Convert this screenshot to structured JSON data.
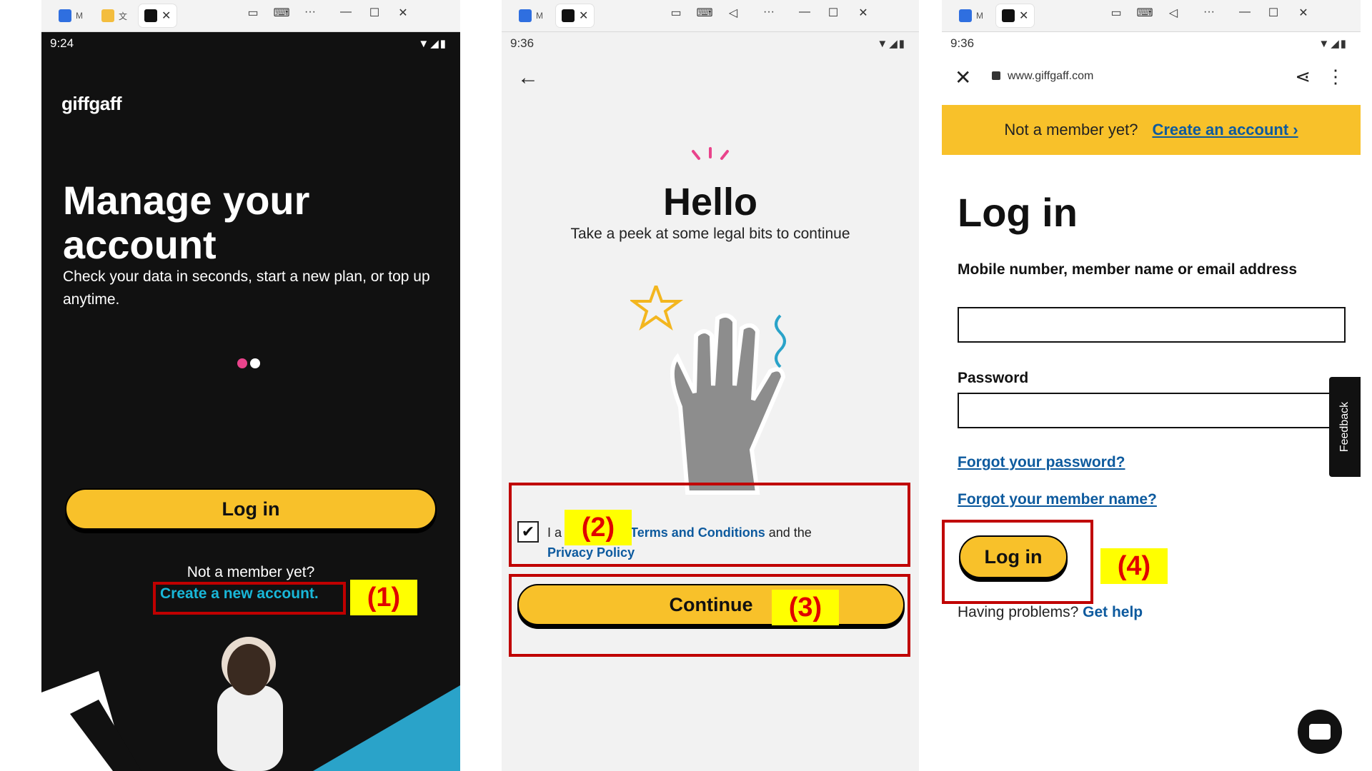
{
  "panel1": {
    "tabs": [
      {
        "label": "M"
      },
      {
        "label": "文"
      },
      {
        "label": ""
      }
    ],
    "time": "9:24",
    "logo": "giffgaff",
    "title": "Manage your account",
    "subtitle": "Check your data in seconds, start a new plan, or top up anytime.",
    "login_button": "Log in",
    "not_member": "Not a member yet?",
    "create_link": "Create a new account.",
    "annotation": "(1)",
    "colors": {
      "background": "#111111",
      "accent": "#f8c12a",
      "link": "#19b7d8",
      "dot_active": "#e9438b"
    }
  },
  "panel2": {
    "tabs": [
      {
        "label": "M"
      },
      {
        "label": ""
      }
    ],
    "time": "9:36",
    "heading": "Hello",
    "subtitle": "Take a peek at some legal bits to continue",
    "consent_prefix": "I a",
    "terms_link": "Terms and Conditions",
    "consent_mid": "and the",
    "privacy_link": "Privacy Policy",
    "checkbox_checked": true,
    "continue_button": "Continue",
    "annotation_checkbox": "(2)",
    "annotation_continue": "(3)"
  },
  "panel3": {
    "tabs": [
      {
        "label": "M"
      },
      {
        "label": ""
      }
    ],
    "time": "9:36",
    "url": "www.giffgaff.com",
    "banner_text": "Not a member yet?",
    "banner_link": "Create an account ›",
    "heading": "Log in",
    "username_label": "Mobile number, member name or email address",
    "username_value": "",
    "password_label": "Password",
    "password_value": "",
    "forgot_password": "Forgot your password?",
    "forgot_member": "Forgot your member name?",
    "login_button": "Log in",
    "problems_text": "Having problems?",
    "get_help": "Get help",
    "feedback": "Feedback",
    "annotation": "(4)"
  },
  "icons": {
    "close": "✕",
    "minimize": "—",
    "maximize": "☐",
    "more": "···",
    "back": "←",
    "share": "⋖",
    "kebab": "⋮",
    "eye_off": "◌"
  }
}
